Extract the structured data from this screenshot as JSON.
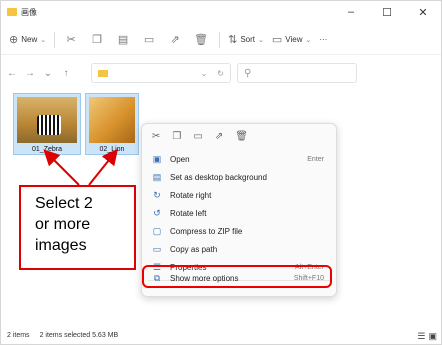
{
  "window": {
    "title": "画像"
  },
  "toolbar": {
    "new_label": "New",
    "sort_label": "Sort",
    "view_label": "View",
    "more_label": "···"
  },
  "files": [
    {
      "name": "01_Zebra"
    },
    {
      "name": "02_Lion"
    }
  ],
  "context_menu": {
    "items": [
      {
        "label": "Open",
        "shortcut": "Enter",
        "icon": "open-icon"
      },
      {
        "label": "Set as desktop background",
        "shortcut": "",
        "icon": "desktop-icon"
      },
      {
        "label": "Rotate right",
        "shortcut": "",
        "icon": "rotate-right-icon"
      },
      {
        "label": "Rotate left",
        "shortcut": "",
        "icon": "rotate-left-icon"
      },
      {
        "label": "Compress to ZIP file",
        "shortcut": "",
        "icon": "zip-icon"
      },
      {
        "label": "Copy as path",
        "shortcut": "",
        "icon": "copy-path-icon"
      },
      {
        "label": "Properties",
        "shortcut": "Alt+Enter",
        "icon": "properties-icon"
      },
      {
        "label": "Show more options",
        "shortcut": "Shift+F10",
        "icon": "more-options-icon"
      }
    ]
  },
  "callout": {
    "line1": "Select 2",
    "line2": "or more",
    "line3": "images"
  },
  "status": {
    "count": "2 items",
    "selected": "2 items selected  5.63 MB"
  },
  "colors": {
    "highlight": "#e00000",
    "selection": "#cce4f7"
  }
}
